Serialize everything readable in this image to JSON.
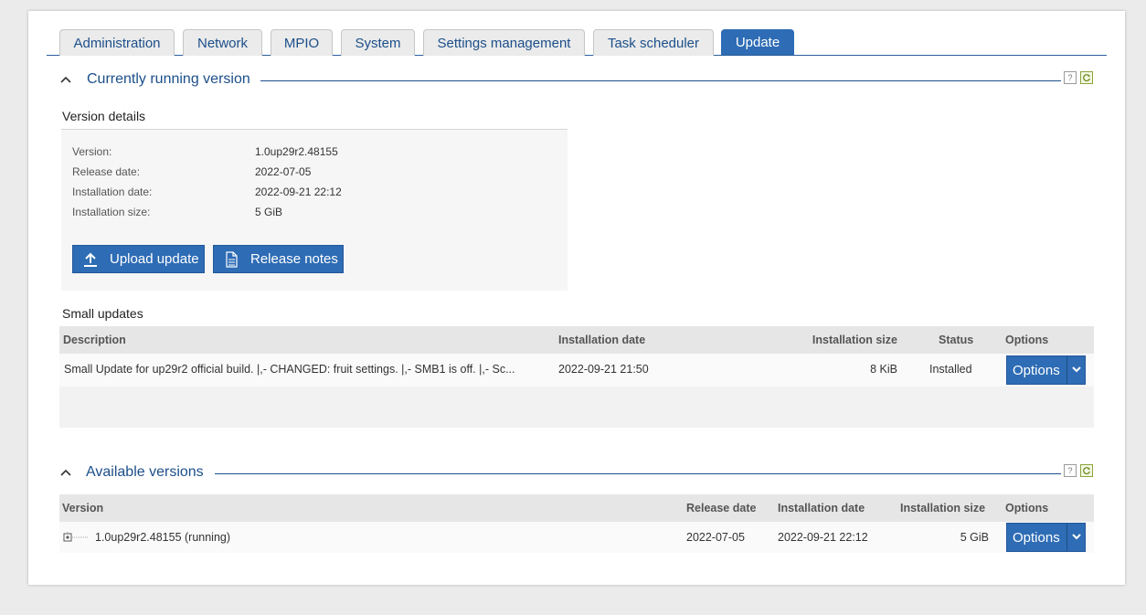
{
  "tabs": [
    "Administration",
    "Network",
    "MPIO",
    "System",
    "Settings management",
    "Task scheduler",
    "Update"
  ],
  "active_tab": "Update",
  "current_section": {
    "title": "Currently running version",
    "help_label": "?",
    "details_title": "Version details",
    "details": [
      {
        "label": "Version:",
        "value": "1.0up29r2.48155"
      },
      {
        "label": "Release date:",
        "value": "2022-07-05"
      },
      {
        "label": "Installation date:",
        "value": "2022-09-21 22:12"
      },
      {
        "label": "Installation size:",
        "value": "5 GiB"
      }
    ],
    "upload_button": "Upload update",
    "release_notes_button": "Release notes"
  },
  "small_updates": {
    "title": "Small updates",
    "columns": {
      "description": "Description",
      "install_date": "Installation date",
      "install_size": "Installation size",
      "status": "Status",
      "options": "Options"
    },
    "rows": [
      {
        "description": "Small Update for up29r2 official build. |,- CHANGED: fruit settings. |,- SMB1 is off. |,- Sc...",
        "install_date": "2022-09-21 21:50",
        "install_size": "8 KiB",
        "status": "Installed",
        "options": "Options"
      }
    ]
  },
  "available_section": {
    "title": "Available versions",
    "help_label": "?",
    "columns": {
      "version": "Version",
      "release_date": "Release date",
      "install_date": "Installation date",
      "install_size": "Installation size",
      "options": "Options"
    },
    "rows": [
      {
        "version": "1.0up29r2.48155 (running)",
        "release_date": "2022-07-05",
        "install_date": "2022-09-21 22:12",
        "install_size": "5 GiB",
        "options": "Options"
      }
    ]
  },
  "colors": {
    "accent": "#2e6cb5",
    "link": "#1c4f8a",
    "header_bg": "#e6e6e6"
  }
}
